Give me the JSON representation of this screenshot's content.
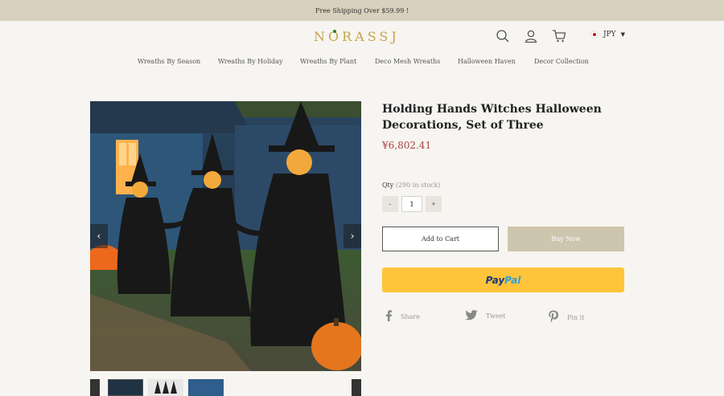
{
  "topbar": {
    "text": "Free Shipping Over $59.99 !"
  },
  "header": {
    "logo_first": "N",
    "logo_o": "O",
    "logo_rest": "RASSJ",
    "currency": "JPY"
  },
  "nav": [
    {
      "label": "Wreaths By Season"
    },
    {
      "label": "Wreaths By Holiday"
    },
    {
      "label": "Wreaths By Plant"
    },
    {
      "label": "Deco Mesh Wreaths"
    },
    {
      "label": "Halloween Haven"
    },
    {
      "label": "Decor Collection"
    }
  ],
  "product": {
    "title": "Holding Hands Witches Halloween Decorations, Set of Three",
    "price": "¥6,802.41",
    "qty_label": "Qty",
    "stock": "(290 in stock)",
    "qty_value": "1",
    "minus": "-",
    "plus": "+",
    "add_to_cart": "Add to Cart",
    "buy_now": "Buy Now",
    "paypal_a": "Pay",
    "paypal_b": "Pal"
  },
  "share": [
    {
      "label": "Share",
      "icon": "facebook-icon"
    },
    {
      "label": "Tweet",
      "icon": "twitter-icon"
    },
    {
      "label": "Pin it",
      "icon": "pinterest-icon"
    }
  ],
  "colors": {
    "topbar": "#d8d1bd",
    "brand": "#c4a54a",
    "price": "#a64545",
    "buy_now": "#cdc5ae",
    "paypal": "#ffc439"
  }
}
